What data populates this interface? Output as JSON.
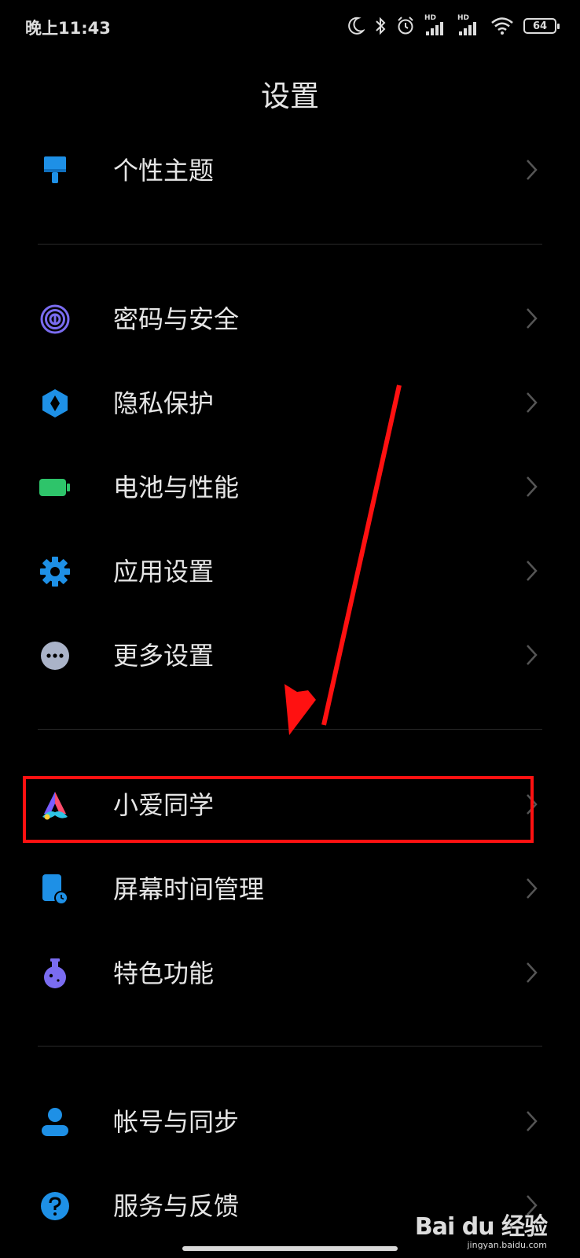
{
  "status": {
    "time": "晚上11:43",
    "battery": "64",
    "hd1": "HD",
    "hd2": "HD"
  },
  "title": "设置",
  "menu": [
    {
      "label": "个性主题",
      "icon": "paintbrush-icon"
    },
    {
      "label": "密码与安全",
      "icon": "fingerprint-icon"
    },
    {
      "label": "隐私保护",
      "icon": "privacy-shield-icon"
    },
    {
      "label": "电池与性能",
      "icon": "battery-icon"
    },
    {
      "label": "应用设置",
      "icon": "gear-icon"
    },
    {
      "label": "更多设置",
      "icon": "more-dots-icon"
    },
    {
      "label": "小爱同学",
      "icon": "xiaoai-icon"
    },
    {
      "label": "屏幕时间管理",
      "icon": "screen-time-icon"
    },
    {
      "label": "特色功能",
      "icon": "flask-icon"
    },
    {
      "label": "帐号与同步",
      "icon": "person-icon"
    },
    {
      "label": "服务与反馈",
      "icon": "help-icon"
    }
  ],
  "watermark": {
    "logo": "Bai du 经验",
    "url": "jingyan.baidu.com"
  },
  "colors": {
    "background": "#000000",
    "accent_blue": "#1e90e6",
    "highlight_red": "#ff1111"
  }
}
